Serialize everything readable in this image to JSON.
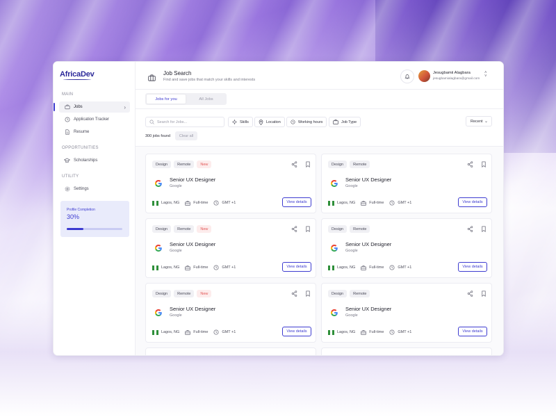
{
  "app": {
    "logo": "AfricaDev"
  },
  "sidebar": {
    "sections": [
      {
        "label": "MAIN",
        "items": [
          {
            "label": "Jobs",
            "icon": "briefcase-icon",
            "active": true
          },
          {
            "label": "Application Tracker",
            "icon": "clock-icon"
          },
          {
            "label": "Resume",
            "icon": "document-icon"
          }
        ]
      },
      {
        "label": "OPPORTUNITIES",
        "items": [
          {
            "label": "Scholarships",
            "icon": "graduation-cap-icon"
          }
        ]
      },
      {
        "label": "UTILITY",
        "items": [
          {
            "label": "Settings",
            "icon": "gear-icon"
          }
        ]
      }
    ],
    "profile": {
      "label": "Profile Completion",
      "value": "30%",
      "progress": 0.3
    }
  },
  "header": {
    "title": "Job Search",
    "subtitle": "Find and save jobs that match your skills and interests",
    "user": {
      "name": "Jesugbamii Alagbara",
      "email": "jesugbamialagbara@gmail.com"
    }
  },
  "tabs": [
    {
      "label": "Jobs for you",
      "active": true
    },
    {
      "label": "All Jobs",
      "active": false
    }
  ],
  "filters": {
    "search_placeholder": "Search for Jobs...",
    "buttons": [
      {
        "label": "Skills",
        "icon": "sparkle-icon"
      },
      {
        "label": "Location",
        "icon": "location-pin-icon"
      },
      {
        "label": "Working hours",
        "icon": "clock-icon"
      },
      {
        "label": "Job Type",
        "icon": "briefcase-icon"
      }
    ],
    "sort": "Recent",
    "count": "300 jobs found",
    "clear": "Clear all"
  },
  "jobs": [
    {
      "tags": [
        "Design",
        "Remote",
        "New"
      ],
      "title": "Senior UX Designer",
      "company": "Google",
      "location": "Lagos, NG",
      "type": "Full-time",
      "timezone": "GMT +1",
      "action": "View details"
    },
    {
      "tags": [
        "Design",
        "Remote",
        "New"
      ],
      "title": "Senior UX Designer",
      "company": "Google",
      "location": "Lagos, NG",
      "type": "Full-time",
      "timezone": "GMT +1",
      "action": "View details"
    },
    {
      "tags": [
        "Design",
        "Remote",
        "New"
      ],
      "title": "Senior UX Designer",
      "company": "Google",
      "location": "Lagos, NG",
      "type": "Full-time",
      "timezone": "GMT +1",
      "action": "View details"
    },
    {
      "tags": [
        "Design",
        "Remote"
      ],
      "title": "Senior UX Designer",
      "company": "Google",
      "location": "Lagos, NG",
      "type": "Full-time",
      "timezone": "GMT +1",
      "action": "View details"
    },
    {
      "tags": [
        "Design",
        "Remote"
      ],
      "title": "Senior UX Designer",
      "company": "Google",
      "location": "Lagos, NG",
      "type": "Full-time",
      "timezone": "GMT +1",
      "action": "View details"
    },
    {
      "tags": [
        "Design",
        "Remote"
      ],
      "title": "Senior UX Designer",
      "company": "Google",
      "location": "Lagos, NG",
      "type": "Full-time",
      "timezone": "GMT +1",
      "action": "View details"
    }
  ],
  "colors": {
    "accent": "#3d3bd0",
    "new_tag": "#e25757",
    "flag_green": "#2f8f3a"
  }
}
